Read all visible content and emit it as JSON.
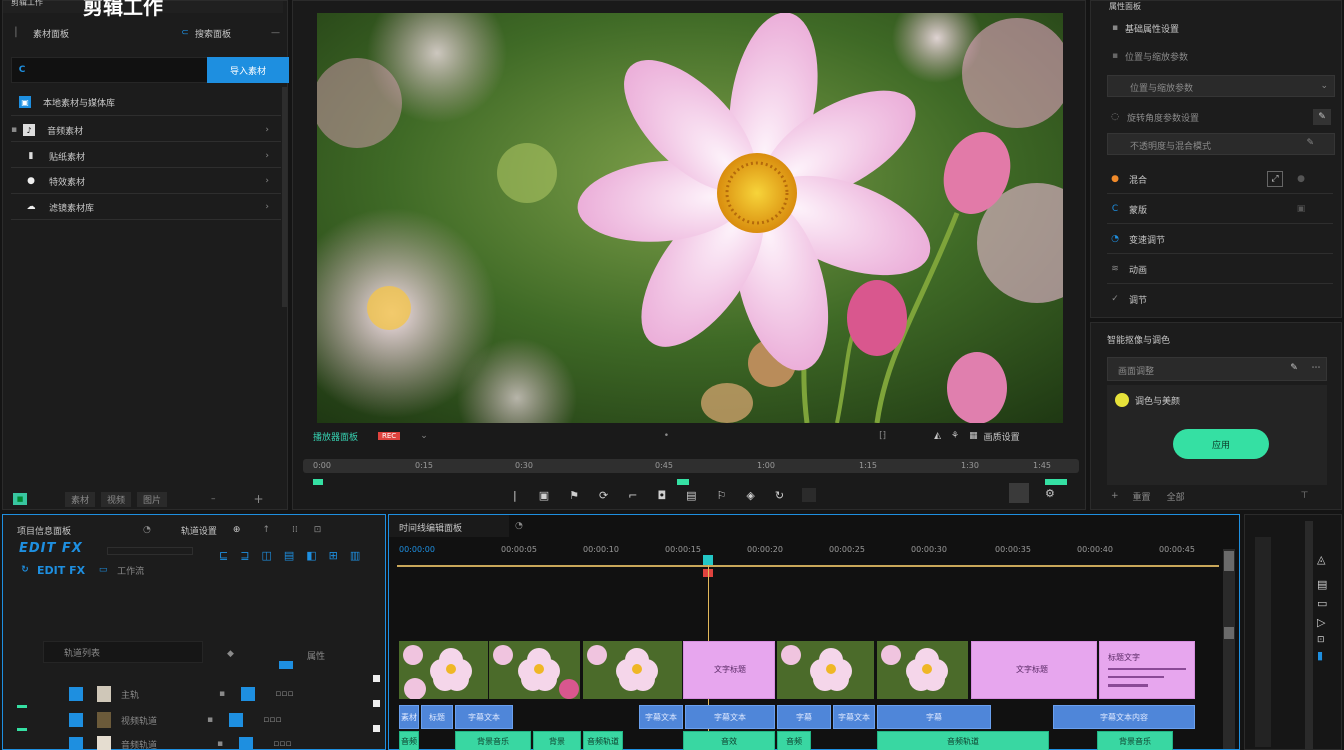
{
  "app": {
    "window_title": "剪辑工作",
    "brand_title": "剪辑工作"
  },
  "left_panel": {
    "tab_media": "素材面板",
    "tab_search": "搜索面板",
    "search_placeholder": "",
    "import_button": "导入素材",
    "items": [
      {
        "label": "本地素材与媒体库",
        "icon": "media-icon"
      },
      {
        "label": "音频素材",
        "icon": "audio-icon"
      },
      {
        "label": "贴纸素材",
        "icon": "sticker-icon"
      },
      {
        "label": "特效素材",
        "icon": "effect-icon"
      },
      {
        "label": "滤镜素材库",
        "icon": "filter-icon"
      }
    ],
    "footer_tabs": [
      "素材",
      "视频",
      "图片"
    ]
  },
  "preview": {
    "label": "播放器面板",
    "record_badge": "REC",
    "time_ticks": [
      "0:00",
      "0:15",
      "0:30",
      "0:45",
      "1:00",
      "1:15",
      "1:30",
      "1:45"
    ],
    "right_controls": [
      "画质设置"
    ]
  },
  "right_panel": {
    "header": "属性面板",
    "subheader": "基础属性设置",
    "fields": [
      {
        "label": "位置与缩放参数"
      },
      {
        "label": "旋转角度参数设置"
      },
      {
        "label": "不透明度与混合模式"
      }
    ],
    "props": [
      {
        "label": "混合"
      },
      {
        "label": "蒙版"
      },
      {
        "label": "变速调节"
      },
      {
        "label": "动画"
      },
      {
        "label": "调节"
      }
    ],
    "lower_header": "智能抠像与调色",
    "lower_field": "画面调整",
    "lower_item": "调色与美颜",
    "apply_button": "应用",
    "footer": [
      "重置",
      "全部"
    ]
  },
  "timeline_left": {
    "header": "项目信息面板",
    "header2": "轨道设置",
    "logo_text": "EDIT FX",
    "tag": "工作流",
    "tracks_header": "轨道列表",
    "col_header": "属性",
    "tracks": [
      {
        "name": "主轨"
      },
      {
        "name": "视频轨道"
      },
      {
        "name": "音频轨道"
      }
    ]
  },
  "timeline": {
    "header": "时间线编辑面板",
    "ticks": [
      "00:00:00",
      "00:00:05",
      "00:00:10",
      "00:00:15",
      "00:00:20",
      "00:00:25",
      "00:00:30",
      "00:00:35",
      "00:00:40",
      "00:00:45"
    ],
    "blue_clips": [
      "素材",
      "标题",
      "字幕文本",
      "字幕文本",
      "字幕文本",
      "字幕",
      "字幕文本",
      "字幕",
      "字幕文本内容"
    ],
    "green_clips": [
      "音频",
      "背景音乐",
      "背景",
      "音频轨道",
      "音效",
      "音频",
      "音频轨道",
      "背景音乐"
    ],
    "pink_clip_labels": [
      "文字标题",
      "文字标题",
      "标题文字"
    ]
  },
  "colors": {
    "accent_blue": "#1e8fe0",
    "accent_green": "#35e0a3",
    "clip_pink": "#e7a6ee",
    "clip_blue": "#4f86d9",
    "playhead": "#e2b85a"
  }
}
